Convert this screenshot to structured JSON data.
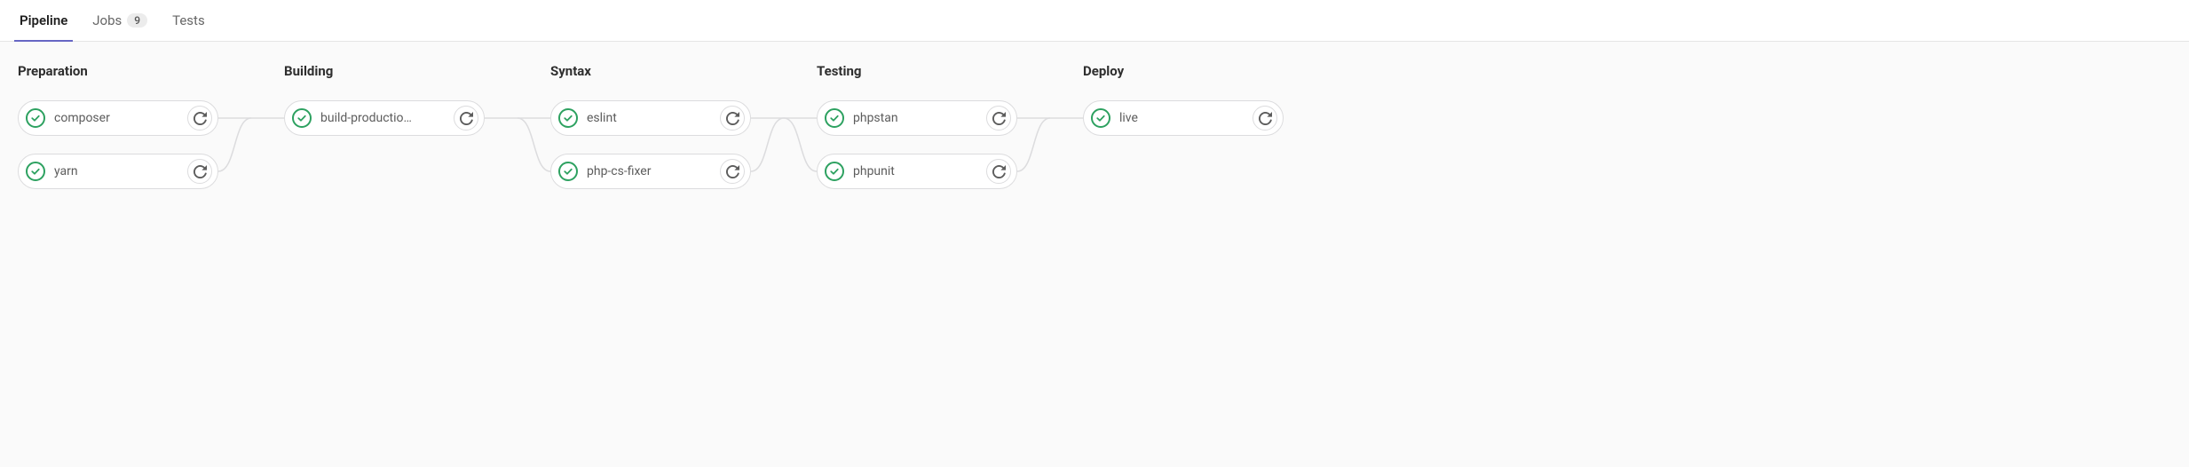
{
  "tabs": [
    {
      "label": "Pipeline",
      "active": true
    },
    {
      "label": "Jobs",
      "badge": "9",
      "active": false
    },
    {
      "label": "Tests",
      "active": false
    }
  ],
  "colors": {
    "success": "#2da160",
    "border": "#dcdcde",
    "tab_underline": "#6666c4"
  },
  "stages": [
    {
      "title": "Preparation",
      "jobs": [
        {
          "name": "composer",
          "status": "passed"
        },
        {
          "name": "yarn",
          "status": "passed"
        }
      ]
    },
    {
      "title": "Building",
      "jobs": [
        {
          "name": "build-productio…",
          "status": "passed"
        }
      ]
    },
    {
      "title": "Syntax",
      "jobs": [
        {
          "name": "eslint",
          "status": "passed"
        },
        {
          "name": "php-cs-fixer",
          "status": "passed"
        }
      ]
    },
    {
      "title": "Testing",
      "jobs": [
        {
          "name": "phpstan",
          "status": "passed"
        },
        {
          "name": "phpunit",
          "status": "passed"
        }
      ]
    },
    {
      "title": "Deploy",
      "jobs": [
        {
          "name": "live",
          "status": "passed"
        }
      ]
    }
  ]
}
